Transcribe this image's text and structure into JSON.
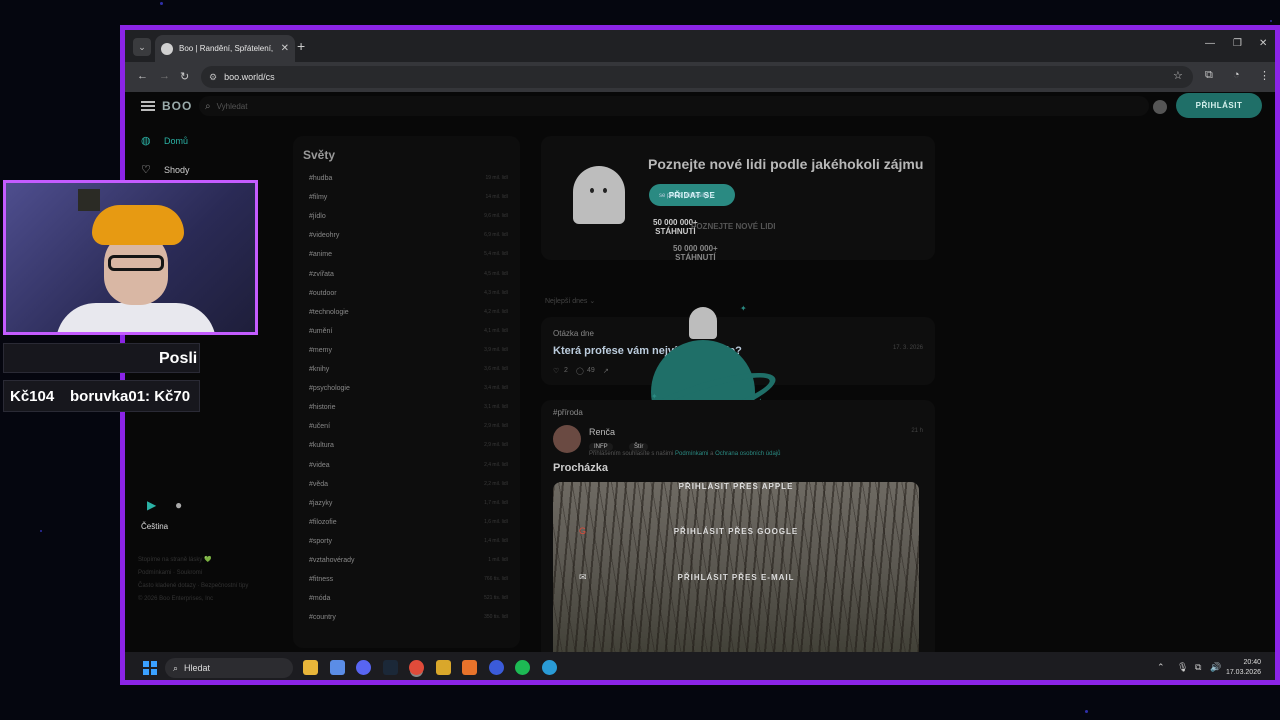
{
  "browser": {
    "tab_title": "Boo | Randění, Spřátelení, Shodi",
    "url": "boo.world/cs",
    "tab_list_glyph": "⌄",
    "tab_close_glyph": "✕",
    "new_tab_glyph": "+",
    "minimize_glyph": "—",
    "maximize_glyph": "❐",
    "close_glyph": "✕"
  },
  "app": {
    "logo": "BOO",
    "search_placeholder": "Vyhledat",
    "login_label": "PŘIHLÁSIT",
    "sidebar": [
      {
        "label": "Domů",
        "icon": "planet-icon",
        "color": "#2bb3a6"
      },
      {
        "label": "Shody",
        "icon": "heart-icon",
        "color": "#cfcfcf"
      }
    ],
    "language": "Čeština",
    "footer": [
      "Stopíme na straně lásky 💚",
      "Podmínkami · Soukromí",
      "Často kladené dotazy · Bezpečnostní tipy",
      "© 2026 Boo Enterprises, Inc"
    ]
  },
  "worlds": {
    "title": "Světy",
    "items": [
      {
        "name": "#hudba",
        "count": "19 mil. lidí"
      },
      {
        "name": "#filmy",
        "count": "14 mil. lidí"
      },
      {
        "name": "#jídlo",
        "count": "9,6 mil. lidí"
      },
      {
        "name": "#videohry",
        "count": "6,9 mil. lidí"
      },
      {
        "name": "#anime",
        "count": "5,4 mil. lidí"
      },
      {
        "name": "#zvířata",
        "count": "4,5 mil. lidí"
      },
      {
        "name": "#outdoor",
        "count": "4,3 mil. lidí"
      },
      {
        "name": "#technologie",
        "count": "4,2 mil. lidí"
      },
      {
        "name": "#umění",
        "count": "4,1 mil. lidí"
      },
      {
        "name": "#memy",
        "count": "3,9 mil. lidí"
      },
      {
        "name": "#knihy",
        "count": "3,6 mil. lidí"
      },
      {
        "name": "#psychologie",
        "count": "3,4 mil. lidí"
      },
      {
        "name": "#historie",
        "count": "3,1 mil. lidí"
      },
      {
        "name": "#učení",
        "count": "2,9 mil. lidí"
      },
      {
        "name": "#kultura",
        "count": "2,9 mil. lidí"
      },
      {
        "name": "#videa",
        "count": "2,4 mil. lidí"
      },
      {
        "name": "#věda",
        "count": "2,2 mil. lidí"
      },
      {
        "name": "#jazyky",
        "count": "1,7 mil. lidí"
      },
      {
        "name": "#filozofie",
        "count": "1,6 mil. lidí"
      },
      {
        "name": "#sporty",
        "count": "1,4 mil. lidí"
      },
      {
        "name": "#vztahovérady",
        "count": "1 mil. lidí"
      },
      {
        "name": "#fitness",
        "count": "766 tis. lidí"
      },
      {
        "name": "#móda",
        "count": "521 tis. lidí"
      },
      {
        "name": "#country",
        "count": "350 tis. lidí"
      }
    ]
  },
  "hero": {
    "title": "Poznejte nové lidi podle jakéhokoli zájmu",
    "join_label": "PŘIDAT SE",
    "toast": "se právě přihlásil(a).",
    "badge_main": "50 000 000+\nSTÁHNUTÍ",
    "badge_ghost": "POZNEJTE NOVÉ LIDI",
    "badge_secondary": "50 000 000+\nSTÁHNUTÍ"
  },
  "sort_label": "Nejlepší dnes ⌄",
  "qotd": {
    "label": "Otázka dne",
    "question": "Která profese vám nejvíc imponuje?",
    "date": "17. 3. 2026",
    "likes": "2",
    "comments": "49"
  },
  "post": {
    "tag": "#příroda",
    "author": "Renča",
    "time": "21 h",
    "mbti": "INFP",
    "zodiac": "Štír",
    "consent_prefix": "Přihlášením souhlasíte s našimi",
    "consent_terms": "Podmínkami",
    "consent_and": "a",
    "consent_privacy": "Ochrana osobních údajů",
    "title": "Procházka",
    "apple_login": "PŘIHLÁSIT PŘES APPLE",
    "google_login": "PŘIHLÁSIT PŘES GOOGLE",
    "email_login": "PŘIHLÁSIT PŘES E-MAIL"
  },
  "taskbar": {
    "search_label": "Hledat",
    "time": "20:40",
    "date": "17.03.2026",
    "apps": [
      {
        "name": "file-explorer-icon",
        "color": "#e8b53a"
      },
      {
        "name": "notepad-icon",
        "color": "#5b8de6"
      },
      {
        "name": "discord-icon",
        "color": "#5865f2"
      },
      {
        "name": "steam-icon",
        "color": "#1b2838"
      },
      {
        "name": "chrome-icon",
        "color": "#e04b3a"
      },
      {
        "name": "game-icon",
        "color": "#d9a72b"
      },
      {
        "name": "firefox-icon",
        "color": "#e8732b"
      },
      {
        "name": "v-app-icon",
        "color": "#3b5bd9"
      },
      {
        "name": "spotify-icon",
        "color": "#1db954"
      },
      {
        "name": "edge-icon",
        "color": "#2a9bd6"
      }
    ]
  },
  "overlay": {
    "ticker_top": "Posli",
    "ticker_bottom_1": "Kč104",
    "ticker_bottom_2": "boruvka01: Kč70"
  },
  "colors": {
    "accent": "#1f6f68",
    "frame": "#8b24e6",
    "webcam_border": "#c45cff"
  }
}
